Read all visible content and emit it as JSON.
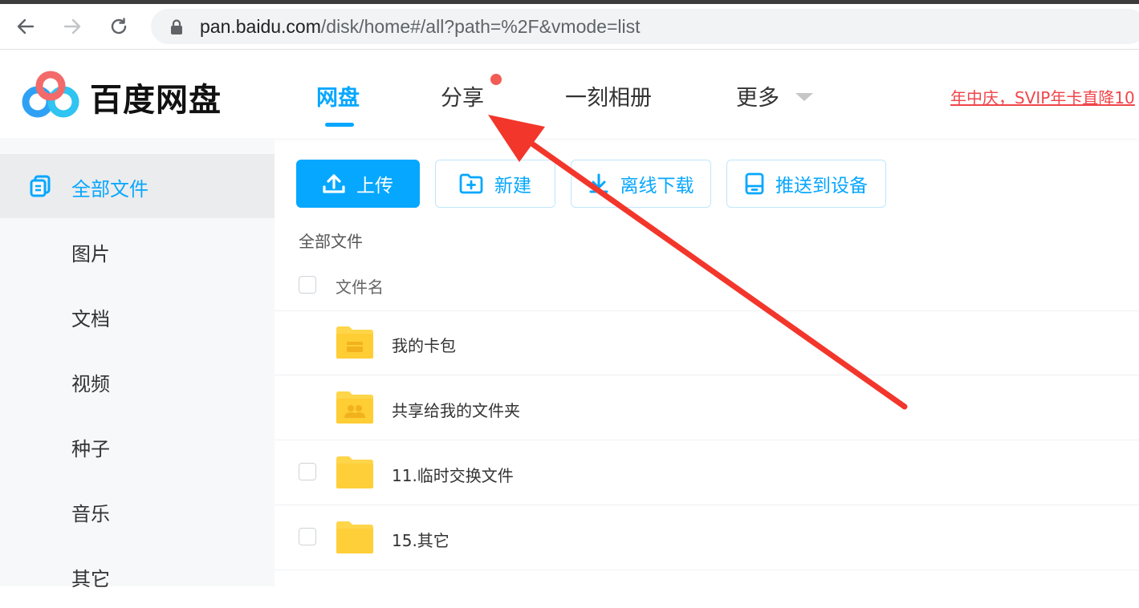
{
  "browser": {
    "url_host": "pan.baidu.com",
    "url_path": "/disk/home#/all?path=%2F&vmode=list"
  },
  "header": {
    "brand": "百度网盘",
    "tabs": [
      "网盘",
      "分享",
      "一刻相册",
      "更多"
    ],
    "active_tab": "网盘",
    "promo": "年中庆，SVIP年卡直降10"
  },
  "sidebar": {
    "items": [
      "全部文件",
      "图片",
      "文档",
      "视频",
      "种子",
      "音乐",
      "其它"
    ],
    "active": "全部文件"
  },
  "toolbar": {
    "upload": "上传",
    "new": "新建",
    "offline_download": "离线下载",
    "push_device": "推送到设备"
  },
  "breadcrumb": "全部文件",
  "file_list": {
    "column_name": "文件名",
    "rows": [
      {
        "name": "我的卡包",
        "icon": "wallet-folder-icon"
      },
      {
        "name": "共享给我的文件夹",
        "icon": "shared-folder-icon"
      },
      {
        "name": "11.临时交换文件",
        "icon": "folder-icon"
      },
      {
        "name": "15.其它",
        "icon": "folder-icon"
      }
    ]
  },
  "colors": {
    "accent": "#06a7ff",
    "promo": "#f0454a",
    "annotation_arrow": "#f3362b",
    "folder": "#ffd54a"
  }
}
